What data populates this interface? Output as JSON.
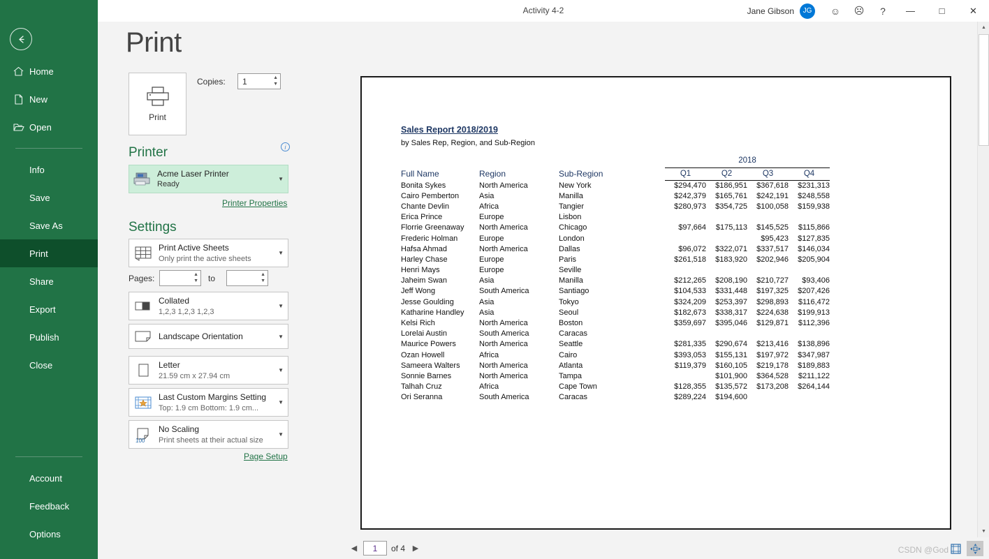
{
  "titlebar": {
    "document_title": "Activity 4-2",
    "user_name": "Jane Gibson",
    "avatar_initials": "JG",
    "smile_icon": "☺",
    "frown_icon": "☹",
    "help_icon": "?",
    "minimize_icon": "—",
    "maximize_icon": "□",
    "close_icon": "✕"
  },
  "sidebar": {
    "back_icon": "←",
    "items": [
      {
        "label": "Home",
        "icon": "home-icon"
      },
      {
        "label": "New",
        "icon": "new-document-icon"
      },
      {
        "label": "Open",
        "icon": "open-folder-icon"
      }
    ],
    "items2": [
      {
        "label": "Info"
      },
      {
        "label": "Save"
      },
      {
        "label": "Save As"
      },
      {
        "label": "Print"
      },
      {
        "label": "Share"
      },
      {
        "label": "Export"
      },
      {
        "label": "Publish"
      },
      {
        "label": "Close"
      }
    ],
    "bottom_items": [
      {
        "label": "Account"
      },
      {
        "label": "Feedback"
      },
      {
        "label": "Options"
      }
    ],
    "active_item": "Print",
    "bg_color": "#217346",
    "active_color": "#0e4f2b"
  },
  "pane": {
    "title": "Print",
    "print_button_label": "Print",
    "copies_label": "Copies:",
    "copies_value": "1",
    "printer_heading": "Printer",
    "printer_name": "Acme Laser Printer",
    "printer_status": "Ready",
    "printer_properties_link": "Printer Properties",
    "settings_heading": "Settings",
    "pages_label": "Pages:",
    "pages_from": "",
    "pages_to": "",
    "to_label": "to",
    "page_setup_link": "Page Setup",
    "options": [
      {
        "title": "Print Active Sheets",
        "subtitle": "Only print the active sheets",
        "icon": "sheet-grid-icon"
      },
      {
        "title": "Collated",
        "subtitle": "1,2,3   1,2,3   1,2,3",
        "icon": "collate-icon"
      },
      {
        "title": "Landscape Orientation",
        "subtitle": "",
        "icon": "landscape-page-icon"
      },
      {
        "title": "Letter",
        "subtitle": "21.59 cm x 27.94 cm",
        "icon": "paper-size-icon"
      },
      {
        "title": "Last Custom Margins Setting",
        "subtitle": "Top: 1.9 cm Bottom: 1.9 cm...",
        "icon": "margins-icon"
      },
      {
        "title": "No Scaling",
        "subtitle": "Print sheets at their actual size",
        "icon": "scaling-icon"
      }
    ]
  },
  "preview": {
    "document": {
      "title": "Sales Report 2018/2019",
      "subtitle": "by Sales Rep, Region, and Sub-Region",
      "group_header": "2018",
      "columns": [
        "Full Name",
        "Region",
        "Sub-Region"
      ],
      "quarter_columns": [
        "Q1",
        "Q2",
        "Q3",
        "Q4"
      ],
      "rows": [
        {
          "name": "Bonita Sykes",
          "region": "North America",
          "sub": "New York",
          "q": [
            "$294,470",
            "$186,951",
            "$367,618",
            "$231,313"
          ]
        },
        {
          "name": "Cairo Pemberton",
          "region": "Asia",
          "sub": "Manilla",
          "q": [
            "$242,379",
            "$165,761",
            "$242,191",
            "$248,558"
          ]
        },
        {
          "name": "Chante Devlin",
          "region": "Africa",
          "sub": "Tangier",
          "q": [
            "$280,973",
            "$354,725",
            "$100,058",
            "$159,938"
          ]
        },
        {
          "name": "Erica Prince",
          "region": "Europe",
          "sub": "Lisbon",
          "q": [
            "",
            "",
            "",
            ""
          ]
        },
        {
          "name": "Florrie Greenaway",
          "region": "North America",
          "sub": "Chicago",
          "q": [
            "$97,664",
            "$175,113",
            "$145,525",
            "$115,866"
          ]
        },
        {
          "name": "Frederic Holman",
          "region": "Europe",
          "sub": "London",
          "q": [
            "",
            "",
            "$95,423",
            "$127,835"
          ]
        },
        {
          "name": "Hafsa Ahmad",
          "region": "North America",
          "sub": "Dallas",
          "q": [
            "$96,072",
            "$322,071",
            "$337,517",
            "$146,034"
          ]
        },
        {
          "name": "Harley Chase",
          "region": "Europe",
          "sub": "Paris",
          "q": [
            "$261,518",
            "$183,920",
            "$202,946",
            "$205,904"
          ]
        },
        {
          "name": "Henri Mays",
          "region": "Europe",
          "sub": "Seville",
          "q": [
            "",
            "",
            "",
            ""
          ]
        },
        {
          "name": "Jaheim Swan",
          "region": "Asia",
          "sub": "Manilla",
          "q": [
            "$212,265",
            "$208,190",
            "$210,727",
            "$93,406"
          ]
        },
        {
          "name": "Jeff Wong",
          "region": "South America",
          "sub": "Santiago",
          "q": [
            "$104,533",
            "$331,448",
            "$197,325",
            "$207,426"
          ]
        },
        {
          "name": "Jesse Goulding",
          "region": "Asia",
          "sub": "Tokyo",
          "q": [
            "$324,209",
            "$253,397",
            "$298,893",
            "$116,472"
          ]
        },
        {
          "name": "Katharine Handley",
          "region": "Asia",
          "sub": "Seoul",
          "q": [
            "$182,673",
            "$338,317",
            "$224,638",
            "$199,913"
          ]
        },
        {
          "name": "Kelsi Rich",
          "region": "North America",
          "sub": "Boston",
          "q": [
            "$359,697",
            "$395,046",
            "$129,871",
            "$112,396"
          ]
        },
        {
          "name": "Lorelai Austin",
          "region": "South America",
          "sub": "Caracas",
          "q": [
            "",
            "",
            "",
            ""
          ]
        },
        {
          "name": "Maurice Powers",
          "region": "North America",
          "sub": "Seattle",
          "q": [
            "$281,335",
            "$290,674",
            "$213,416",
            "$138,896"
          ]
        },
        {
          "name": "Ozan Howell",
          "region": "Africa",
          "sub": "Cairo",
          "q": [
            "$393,053",
            "$155,131",
            "$197,972",
            "$347,987"
          ]
        },
        {
          "name": "Sameera Walters",
          "region": "North America",
          "sub": "Atlanta",
          "q": [
            "$119,379",
            "$160,105",
            "$219,178",
            "$189,883"
          ]
        },
        {
          "name": "Sonnie Barnes",
          "region": "North America",
          "sub": "Tampa",
          "q": [
            "",
            "$101,900",
            "$364,528",
            "$211,122"
          ]
        },
        {
          "name": "Talhah Cruz",
          "region": "Africa",
          "sub": "Cape Town",
          "q": [
            "$128,355",
            "$135,572",
            "$173,208",
            "$264,144"
          ]
        },
        {
          "name": "Ori Seranna",
          "region": "South America",
          "sub": "Caracas",
          "q": [
            "$289,224",
            "$194,600",
            "",
            ""
          ]
        }
      ]
    },
    "bottom": {
      "prev_icon": "◀",
      "next_icon": "▶",
      "current_page": "1",
      "of_pages": "of 4",
      "show_margins_icon": "show-margins-icon",
      "zoom_to_page_icon": "zoom-to-page-icon",
      "watermark": "CSDN @God"
    }
  }
}
